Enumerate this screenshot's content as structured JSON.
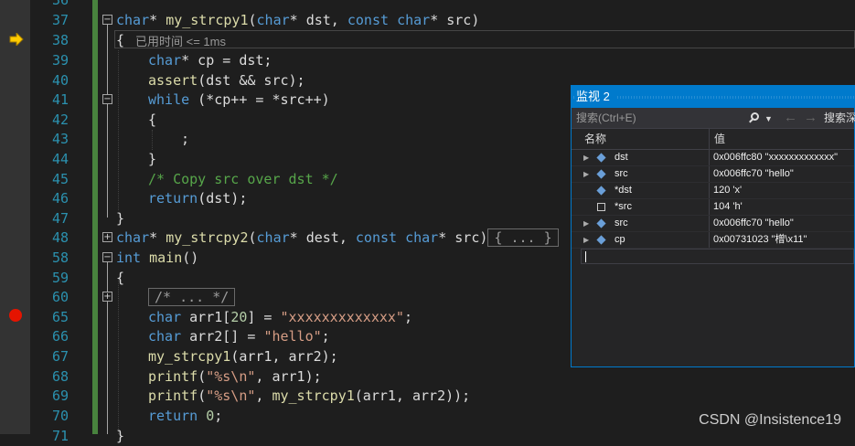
{
  "editor": {
    "line_numbers": [
      "36",
      "37",
      "38",
      "39",
      "40",
      "41",
      "42",
      "43",
      "44",
      "45",
      "46",
      "47",
      "48",
      "58",
      "59",
      "60",
      "65",
      "66",
      "67",
      "68",
      "69",
      "70",
      "71"
    ],
    "perf_tip": "已用时间 <= 1ms",
    "lines": {
      "l37": {
        "a": "char",
        "b": "* ",
        "c": "my_strcpy1",
        "d": "(",
        "e": "char",
        "f": "* dst, ",
        "g": "const",
        "h": " ",
        "i": "char",
        "j": "* src)"
      },
      "l38": "{",
      "l39": {
        "a": "char",
        "b": "* cp = dst;"
      },
      "l40": {
        "a": "assert",
        "b": "(dst && src);"
      },
      "l41": {
        "a": "while",
        "b": " (*cp++ = *src++)"
      },
      "l42": "{",
      "l43": ";",
      "l44": "}",
      "l45": "/* Copy src over dst */",
      "l46": {
        "a": "return",
        "b": "(dst);"
      },
      "l47": "}",
      "l48": {
        "a": "char",
        "b": "* ",
        "c": "my_strcpy2",
        "d": "(",
        "e": "char",
        "f": "* dest, ",
        "g": "const",
        "h": " ",
        "i": "char",
        "j": "* src)",
        "collapsed": "{ ... }"
      },
      "l58": {
        "a": "int",
        "b": " ",
        "c": "main",
        "d": "()"
      },
      "l59": "{",
      "l60": "/* ... */",
      "l65": {
        "a": "char",
        "b": " arr1[",
        "n": "20",
        "c": "] = ",
        "s": "\"xxxxxxxxxxxxx\"",
        "d": ";"
      },
      "l66": {
        "a": "char",
        "b": " arr2[] = ",
        "s": "\"hello\"",
        "d": ";"
      },
      "l67": {
        "a": "my_strcpy1",
        "b": "(arr1, arr2);"
      },
      "l68": {
        "a": "printf",
        "b": "(",
        "s": "\"%s\\n\"",
        "d": ", arr1);"
      },
      "l69": {
        "a": "printf",
        "b": "(",
        "s": "\"%s\\n\"",
        "d": ", ",
        "e": "my_strcpy1",
        "f": "(arr1, arr2));"
      },
      "l70": {
        "a": "return",
        "b": " ",
        "n": "0",
        "d": ";"
      },
      "l71": "}"
    }
  },
  "watch": {
    "title": "监视 2",
    "search_placeholder": "搜索(Ctrl+E)",
    "search_depth_label": "搜索深",
    "columns": {
      "name": "名称",
      "value": "值"
    },
    "rows": [
      {
        "name": "dst",
        "value": "0x006ffc80 \"xxxxxxxxxxxxx\"",
        "icon": "variable-icon",
        "expandable": true
      },
      {
        "name": "src",
        "value": "0x006ffc70 \"hello\"",
        "icon": "variable-icon",
        "expandable": true
      },
      {
        "name": "*dst",
        "value": "120 'x'",
        "icon": "variable-icon",
        "expandable": false
      },
      {
        "name": "*src",
        "value": "104 'h'",
        "icon": "field-icon",
        "expandable": false
      },
      {
        "name": "src",
        "value": "0x006ffc70 \"hello\"",
        "icon": "variable-icon",
        "expandable": true
      },
      {
        "name": "cp",
        "value": "0x00731023 \"橧\\x11\"",
        "icon": "variable-icon",
        "expandable": true
      }
    ]
  },
  "watermark": "CSDN @Insistence19",
  "colors": {
    "keyword": "#569cd6",
    "function": "#dcdcaa",
    "string": "#d69d85",
    "comment": "#57a64a",
    "accent": "#007acc",
    "breakpoint": "#e51400"
  }
}
